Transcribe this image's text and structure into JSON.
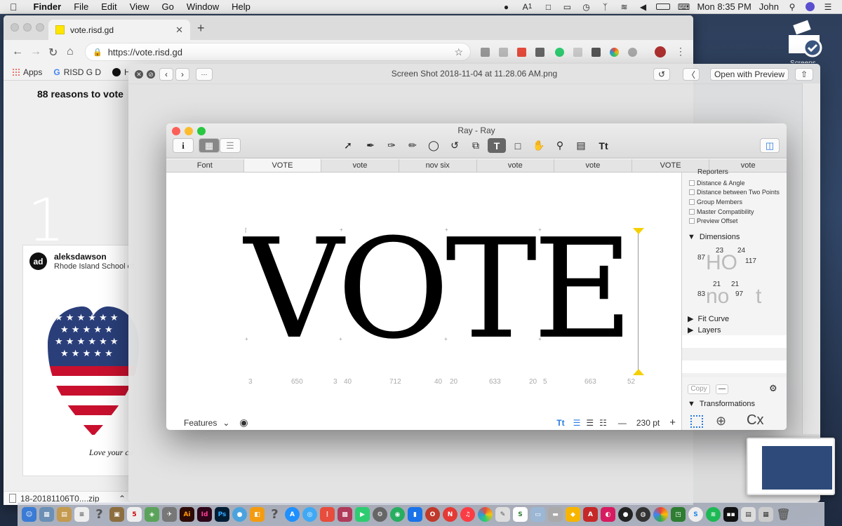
{
  "menubar": {
    "app": "Finder",
    "items": [
      "File",
      "Edit",
      "View",
      "Go",
      "Window",
      "Help"
    ],
    "clock": "Mon 8:35 PM",
    "user": "John",
    "status_badge": "1"
  },
  "browser": {
    "tab_title": "vote.risd.gd",
    "url": "https://vote.risd.gd",
    "bookmarks": [
      "Apps",
      "RISD G D",
      "Ho"
    ],
    "page": {
      "heading": "88 reasons to vote",
      "big_number": "1",
      "post": {
        "avatar": "ad",
        "username": "aleksdawson",
        "subtitle": "Rhode Island School of",
        "caption": "Love your co"
      }
    },
    "download": "18-20181106T0....zip"
  },
  "quicklook": {
    "title": "Screen Shot 2018-11-04 at 11.28.06 AM.png",
    "open_with": "Open with Preview"
  },
  "ray": {
    "title": "Ray - Ray",
    "tabs": [
      "Font",
      "VOTE",
      "vote",
      "nov six",
      "vote",
      "vote",
      "VOTE",
      "vote"
    ],
    "active_tab": 1,
    "text": "VOTE",
    "advances": [
      "3",
      "650",
      "3",
      "40",
      "712",
      "40",
      "20",
      "633",
      "20",
      "5",
      "663",
      "52"
    ],
    "features_label": "Features",
    "zoom": "230 pt",
    "panel": {
      "reporters_label": "Reporters",
      "checks": [
        "Distance & Angle",
        "Distance between Two Points",
        "Group Members",
        "Master Compatibility",
        "Preview Offset"
      ],
      "dimensions": "Dimensions",
      "upper": {
        "glyphs": "HO",
        "a": "87",
        "b": "23",
        "c": "24",
        "d": "117"
      },
      "lower": {
        "glyphs": "no",
        "t": "t",
        "a": "83",
        "b": "21",
        "c": "21",
        "d": "97"
      },
      "fit_curve": "Fit Curve",
      "layers": "Layers",
      "copy": "Copy",
      "transformations": "Transformations",
      "transform_text": "Cx"
    }
  },
  "desktop": {
    "icon_label": "Screens"
  }
}
